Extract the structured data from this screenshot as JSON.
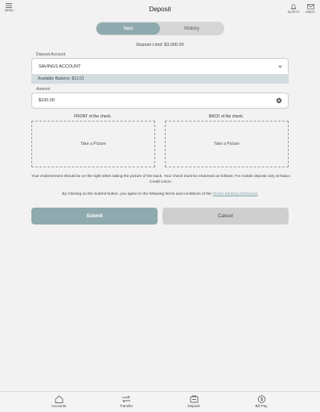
{
  "header": {
    "title": "Deposit",
    "menu_label": "MENU",
    "alerts_label": "ALERTS",
    "inbox_label": "INBOX"
  },
  "tabs": {
    "new_label": "New",
    "history_label": "History",
    "active": "New"
  },
  "form": {
    "deposit_limit": "Deposit Limit: $3,000.00",
    "account_label": "Deposit Account",
    "account_value": "SAVINGS ACCOUNT",
    "available_balance": "Available Balance: $12.01",
    "amount_label": "Amount",
    "amount_value": "$100.00",
    "front_label": "FRONT of the check.",
    "back_label": "BACK of the check.",
    "front_action": "Take a Picture",
    "back_action": "Take a Picture",
    "endorsement_note": "Your endorsement should be on the right when taking the picture of the back. Your check must be endorsed as follows: For mobile deposit only at Natco Credit Union.",
    "terms_text": "By Clicking on the Submit button, you agree to the following terms and conditions of the",
    "terms_link": "Online Banking Disclosure"
  },
  "actions": {
    "submit_label": "Submit",
    "cancel_label": "Cancel"
  },
  "tabbar": {
    "accounts": "Accounts",
    "transfer": "Transfer",
    "deposit": "Deposit",
    "bill_pay": "Bill Pay"
  },
  "colors": {
    "accent": "#8faaae",
    "background": "#f2f2f2",
    "balance_bg": "#d4dcdf",
    "cancel_bg": "#cfcfcf"
  }
}
